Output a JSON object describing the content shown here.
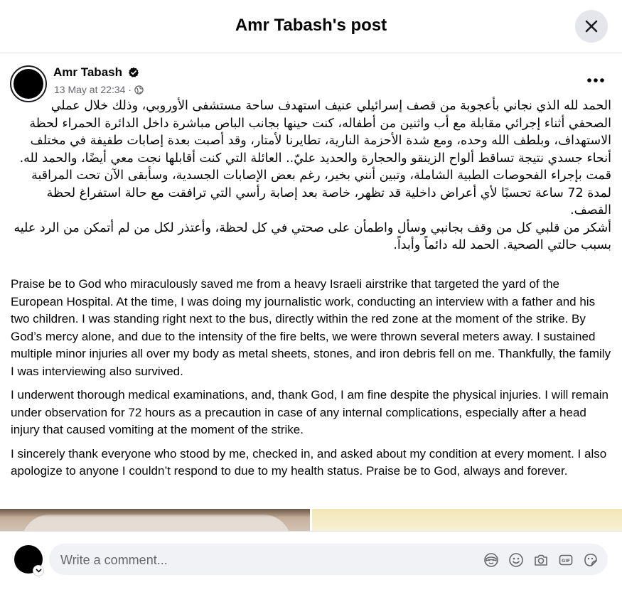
{
  "header": {
    "title": "Amr Tabash's post"
  },
  "post": {
    "author": "Amr Tabash",
    "timestamp": "13 May at 22:34",
    "audience_icon": "globe-icon",
    "arabic_paragraphs": [
      "الحمد لله الذي نجاني بأعجوبة من قصف إسرائيلي عنيف استهدف ساحة مستشفى الأوروبي، وذلك خلال عملي الصحفي أثناء إجرائي مقابلة مع أب واثنين من أطفاله، كنت حينها بجانب الباص مباشرة داخل الدائرة الحمراء لحظة الاستهداف، وبلطف الله وحده، ومع شدة الأحزمة النارية، تطايرنا لأمتار، وقد أصبت بعدة إصابات طفيفة في مختلف أنحاء جسدي نتيجة تساقط ألواح الزينقو والحجارة والحديد عليّ.. العائلة التي كنت أقابلها نجت معي أيضًا، والحمد لله.",
      "قمت بإجراء الفحوصات الطبية الشاملة، وتبين أنني بخير، رغم بعض الإصابات الجسدية، وسأبقى الآن تحت المراقبة لمدة 72 ساعة تحسبًا لأي أعراض داخلية قد تظهر، خاصة بعد إصابة رأسي التي ترافقت مع حالة استفراغ لحظة القصف.",
      "أشكر من قلبي كل من وقف بجانبي وسأل واطمأن على صحتي في كل لحظة، وأعتذر لكل من لم أتمكن من الرد عليه بسبب حالتي الصحية. الحمد لله دائماً وأبداً."
    ],
    "english_paragraphs": [
      "Praise be to God who miraculously saved me from a heavy Israeli airstrike that targeted the yard of the European Hospital. At the time, I was doing my journalistic work, conducting an interview with a father and his two children. I was standing right next to the bus, directly within the red zone at the moment of the strike. By God’s mercy alone, and due to the intensity of the fire belts, we were thrown several meters away. I sustained multiple minor injuries all over my body as metal sheets, stones, and iron debris fell on me. Thankfully, the family I was interviewing also survived.",
      "I underwent thorough medical examinations, and, thank God, I am fine despite the physical injuries. I will remain under observation for 72 hours as a precaution in case of any internal complications, especially after a head injury that caused vomiting at the moment of the strike.",
      "I sincerely thank everyone who stood by me, checked in, and asked about my condition at every moment. I also apologize to anyone I couldn’t respond to due to my health status. Praise be to God, always and forever."
    ]
  },
  "comment": {
    "placeholder": "Write a comment...",
    "icons": [
      "avatar-sticker-icon",
      "emoji-icon",
      "camera-icon",
      "gif-icon",
      "sticker-icon"
    ]
  },
  "colors": {
    "secondary_text": "#65676b",
    "button_bg": "#e4e6eb",
    "input_bg": "#f0f2f5",
    "verified_badge": "#050505"
  }
}
